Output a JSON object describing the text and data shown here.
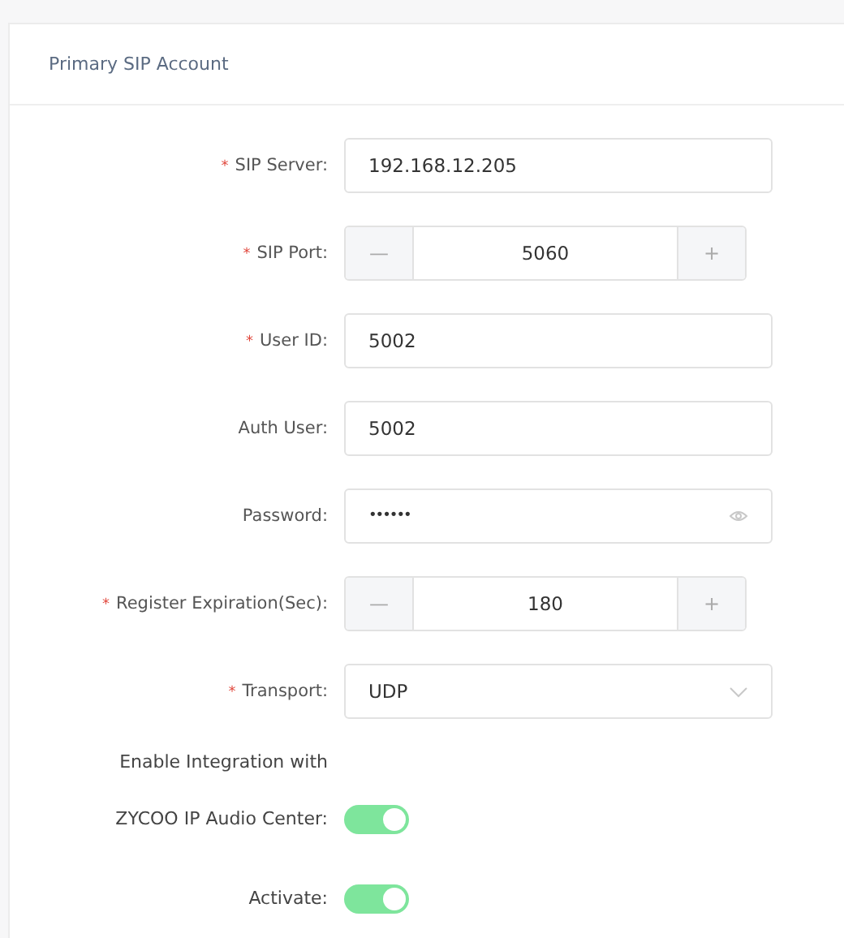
{
  "panel": {
    "title": "Primary SIP Account"
  },
  "fields": [
    {
      "kind": "text",
      "label": "SIP Server:",
      "required": true,
      "value": "192.168.12.205"
    },
    {
      "kind": "stepper",
      "label": "SIP Port:",
      "required": true,
      "value": "5060",
      "minus": "—",
      "plus": "+"
    },
    {
      "kind": "text",
      "label": "User ID:",
      "required": true,
      "value": "5002"
    },
    {
      "kind": "text",
      "label": "Auth User:",
      "required": false,
      "value": "5002"
    },
    {
      "kind": "password",
      "label": "Password:",
      "required": false,
      "value": "••••••"
    },
    {
      "kind": "stepper",
      "label": "Register Expiration(Sec):",
      "required": true,
      "value": "180",
      "minus": "—",
      "plus": "+"
    },
    {
      "kind": "select",
      "label": "Transport:",
      "required": true,
      "value": "UDP"
    }
  ],
  "toggles": [
    {
      "label_lines": [
        "Enable Integration with",
        "ZYCOO IP Audio Center:"
      ],
      "on": true
    },
    {
      "label_lines": [
        "Activate:"
      ],
      "on": true
    }
  ],
  "required_mark": "*"
}
